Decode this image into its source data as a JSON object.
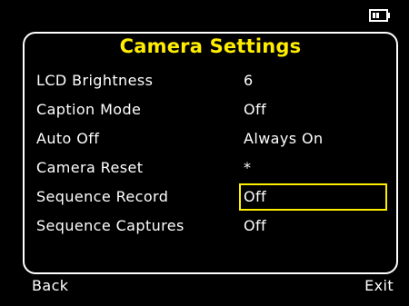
{
  "status": {
    "battery_icon": "battery-icon",
    "battery_level": 0.4
  },
  "screen": {
    "title": "Camera Settings",
    "title_color": "#ffee00",
    "highlight_color": "#ffee00",
    "settings": [
      {
        "label": "LCD Brightness",
        "value": "6"
      },
      {
        "label": "Caption Mode",
        "value": "Off"
      },
      {
        "label": "Auto Off",
        "value": "Always On"
      },
      {
        "label": "Camera Reset",
        "value": "*"
      },
      {
        "label": "Sequence Record",
        "value": "Off",
        "selected": true
      },
      {
        "label": "Sequence Captures",
        "value": "Off"
      }
    ]
  },
  "softkeys": {
    "left": "Back",
    "right": "Exit"
  }
}
